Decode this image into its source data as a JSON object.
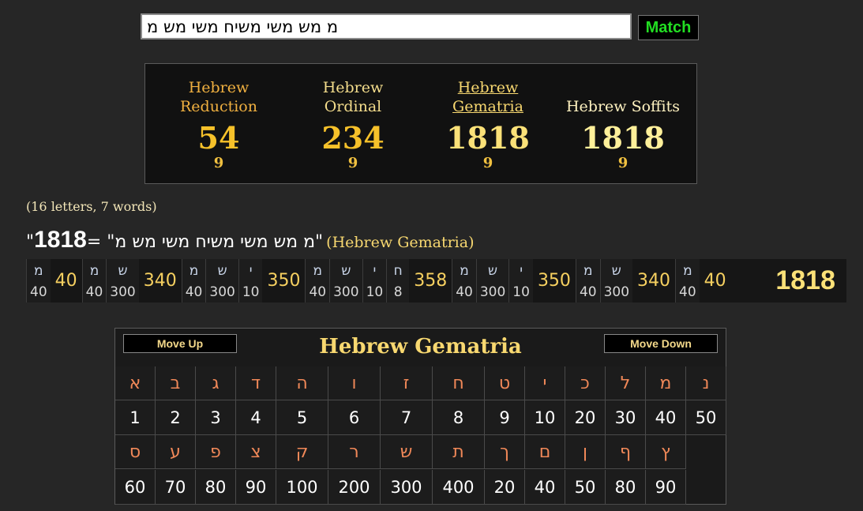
{
  "search": {
    "value": "מ מש משי משיח משי מש מ",
    "button": "Match"
  },
  "summary": [
    {
      "name": "Hebrew Reduction",
      "value": "54",
      "sub": "9"
    },
    {
      "name": "Hebrew Ordinal",
      "value": "234",
      "sub": "9"
    },
    {
      "name": "Hebrew Gematria",
      "value": "1818",
      "sub": "9"
    },
    {
      "name": "Hebrew Soffits",
      "value": "1818",
      "sub": "9"
    }
  ],
  "count_text": "(16 letters, 7 words)",
  "result": {
    "quote_open": "\"",
    "total": "1818",
    "equals": " = \"",
    "phrase": "מ מש משי משיח משי מש מ",
    "quote_close": "\"",
    "cipher": "(Hebrew Gematria)"
  },
  "breakdown": {
    "words": [
      {
        "letters": [
          [
            "מ",
            "40"
          ]
        ],
        "total": "40"
      },
      {
        "letters": [
          [
            "מ",
            "40"
          ],
          [
            "ש",
            "300"
          ]
        ],
        "total": "340"
      },
      {
        "letters": [
          [
            "מ",
            "40"
          ],
          [
            "ש",
            "300"
          ],
          [
            "י",
            "10"
          ]
        ],
        "total": "350"
      },
      {
        "letters": [
          [
            "מ",
            "40"
          ],
          [
            "ש",
            "300"
          ],
          [
            "י",
            "10"
          ],
          [
            "ח",
            "8"
          ]
        ],
        "total": "358"
      },
      {
        "letters": [
          [
            "מ",
            "40"
          ],
          [
            "ש",
            "300"
          ],
          [
            "י",
            "10"
          ]
        ],
        "total": "350"
      },
      {
        "letters": [
          [
            "מ",
            "40"
          ],
          [
            "ש",
            "300"
          ]
        ],
        "total": "340"
      },
      {
        "letters": [
          [
            "מ",
            "40"
          ]
        ],
        "total": "40"
      }
    ],
    "grand_total": "1818"
  },
  "table": {
    "title": "Hebrew Gematria",
    "move_up": "Move Up",
    "move_down": "Move Down",
    "row1_letters": [
      "א",
      "ב",
      "ג",
      "ד",
      "ה",
      "ו",
      "ז",
      "ח",
      "ט",
      "י",
      "כ",
      "ל",
      "מ",
      "נ"
    ],
    "row1_values": [
      "1",
      "2",
      "3",
      "4",
      "5",
      "6",
      "7",
      "8",
      "9",
      "10",
      "20",
      "30",
      "40",
      "50"
    ],
    "row2_letters": [
      "ס",
      "ע",
      "פ",
      "צ",
      "ק",
      "ר",
      "ש",
      "ת",
      "ך",
      "ם",
      "ן",
      "ף",
      "ץ"
    ],
    "row2_values": [
      "60",
      "70",
      "80",
      "90",
      "100",
      "200",
      "300",
      "400",
      "20",
      "40",
      "50",
      "80",
      "90"
    ]
  }
}
